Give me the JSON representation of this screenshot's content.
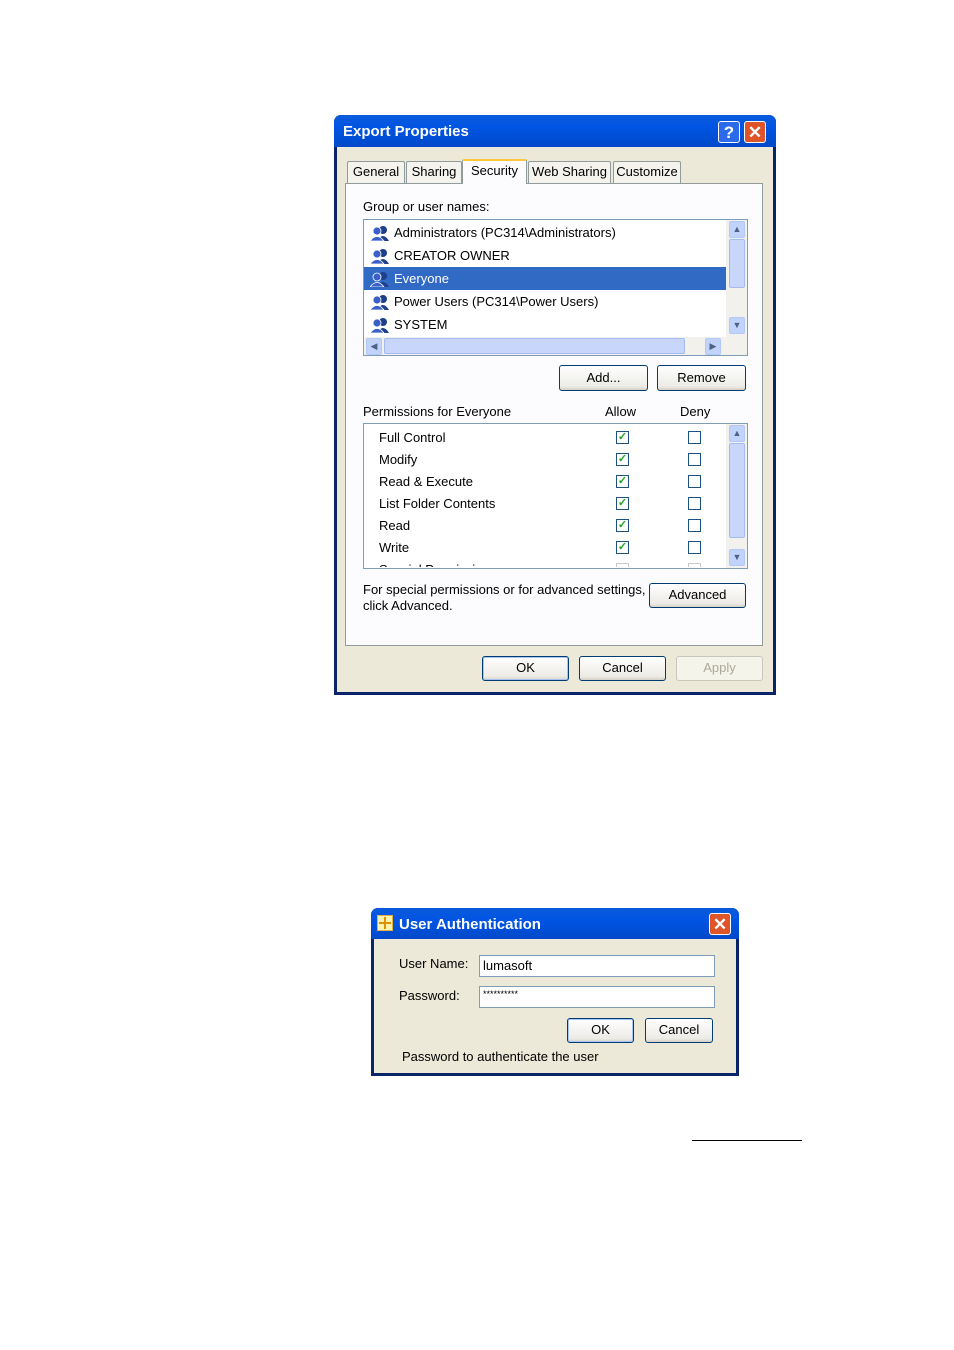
{
  "export_properties": {
    "title": "Export Properties",
    "help_glyph": "?",
    "close_glyph": "✕",
    "tabs": [
      {
        "label": "General"
      },
      {
        "label": "Sharing"
      },
      {
        "label": "Security",
        "active": true
      },
      {
        "label": "Web Sharing"
      },
      {
        "label": "Customize"
      }
    ],
    "group_label": "Group or user names:",
    "users": [
      {
        "name": "Administrators (PC314\\Administrators)",
        "icon": "user-group-icon"
      },
      {
        "name": "CREATOR OWNER",
        "icon": "user-group-icon"
      },
      {
        "name": "Everyone",
        "icon": "user-group-icon",
        "selected": true
      },
      {
        "name": "Power Users (PC314\\Power Users)",
        "icon": "user-group-icon"
      },
      {
        "name": "SYSTEM",
        "icon": "user-group-icon"
      }
    ],
    "add_label": "Add...",
    "remove_label": "Remove",
    "permissions_label": "Permissions for Everyone",
    "allow_header": "Allow",
    "deny_header": "Deny",
    "permissions": [
      {
        "name": "Full Control",
        "allow": true,
        "deny": false
      },
      {
        "name": "Modify",
        "allow": true,
        "deny": false
      },
      {
        "name": "Read & Execute",
        "allow": true,
        "deny": false
      },
      {
        "name": "List Folder Contents",
        "allow": true,
        "deny": false
      },
      {
        "name": "Read",
        "allow": true,
        "deny": false
      },
      {
        "name": "Write",
        "allow": true,
        "deny": false
      },
      {
        "name": "Special Permissions",
        "allow": false,
        "deny": false
      }
    ],
    "advanced_note_line1": "For special permissions or for advanced settings,",
    "advanced_note_line2": "click Advanced.",
    "advanced_label": "Advanced",
    "ok_label": "OK",
    "cancel_label": "Cancel",
    "apply_label": "Apply"
  },
  "user_auth": {
    "title": "User Authentication",
    "close_glyph": "✕",
    "username_label": "User Name:",
    "username_value": "lumasoft",
    "password_label": "Password:",
    "password_value": "**********",
    "ok_label": "OK",
    "cancel_label": "Cancel",
    "status_text": "Password to authenticate the user"
  },
  "colors": {
    "titlebar": "#0054E3",
    "selection": "#316AC5",
    "dialog_bg": "#ECE9D8",
    "close_button": "#E0542A"
  }
}
